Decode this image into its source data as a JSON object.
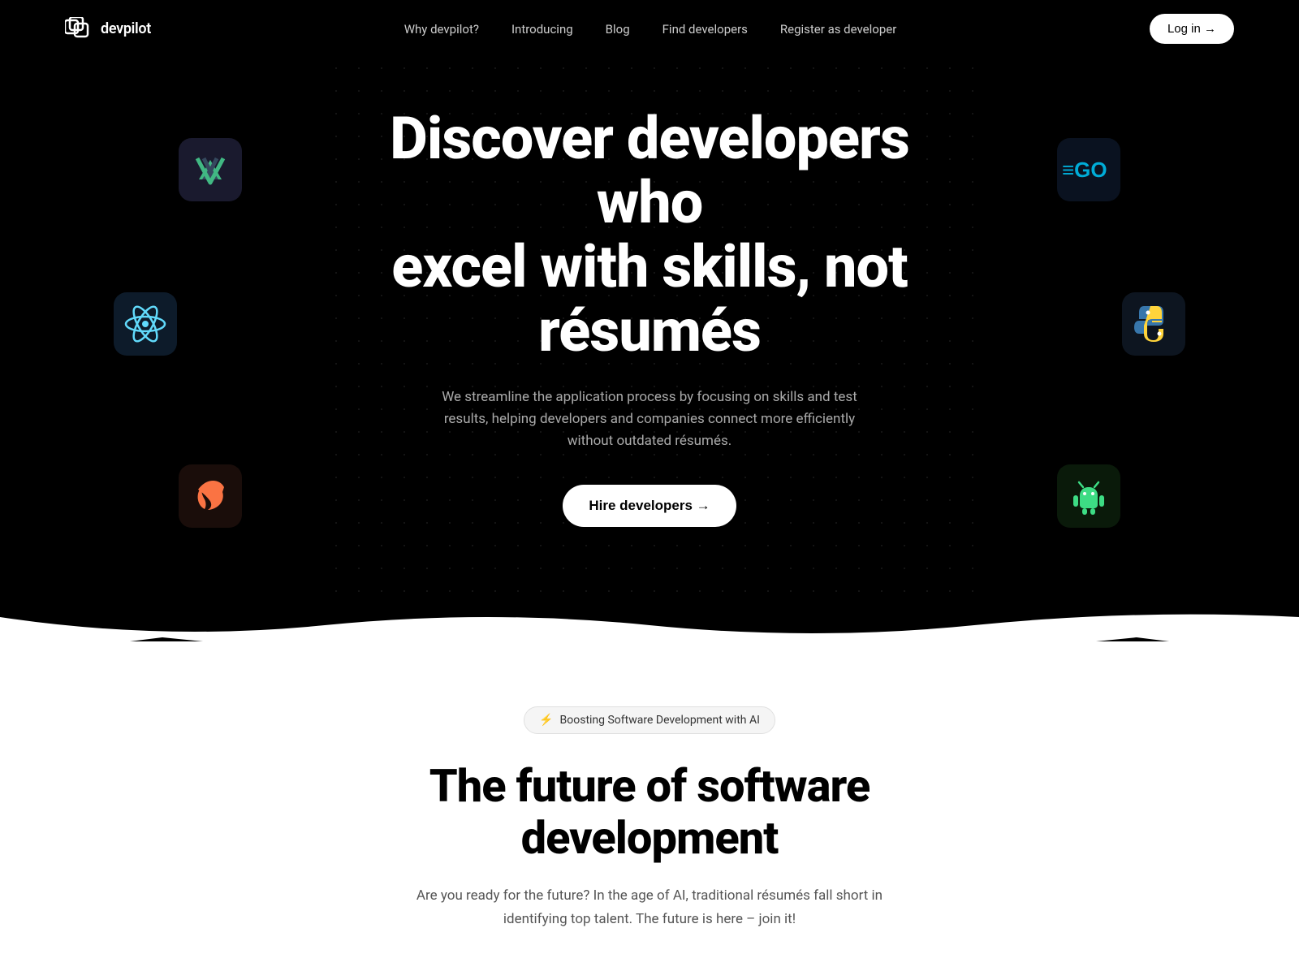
{
  "navbar": {
    "logo_text": "devpilot",
    "nav_items": [
      {
        "label": "Why devpilot?",
        "href": "#"
      },
      {
        "label": "Introducing",
        "href": "#"
      },
      {
        "label": "Blog",
        "href": "#"
      },
      {
        "label": "Find developers",
        "href": "#"
      },
      {
        "label": "Register as developer",
        "href": "#"
      }
    ],
    "login_label": "Log in →"
  },
  "hero": {
    "title_line1": "Discover developers who",
    "title_line2": "excel with skills, not résumés",
    "subtitle": "We streamline the application process by focusing on skills and test results, helping developers and companies connect more efficiently without outdated résumés.",
    "cta_label": "Hire developers →",
    "tech_icons": [
      {
        "name": "Vue.js",
        "position": "top-left"
      },
      {
        "name": "React",
        "position": "mid-left"
      },
      {
        "name": "Swift",
        "position": "bottom-left"
      },
      {
        "name": "Go",
        "position": "top-right"
      },
      {
        "name": "Python",
        "position": "mid-right"
      },
      {
        "name": "Android",
        "position": "bottom-right"
      }
    ]
  },
  "second_section": {
    "badge_icon": "⚡",
    "badge_text": "Boosting Software Development with AI",
    "title_line1": "The future of software",
    "title_line2": "development",
    "subtitle": "Are you ready for the future? In the age of AI, traditional résumés fall short in identifying top talent. The future is here – join it!"
  }
}
